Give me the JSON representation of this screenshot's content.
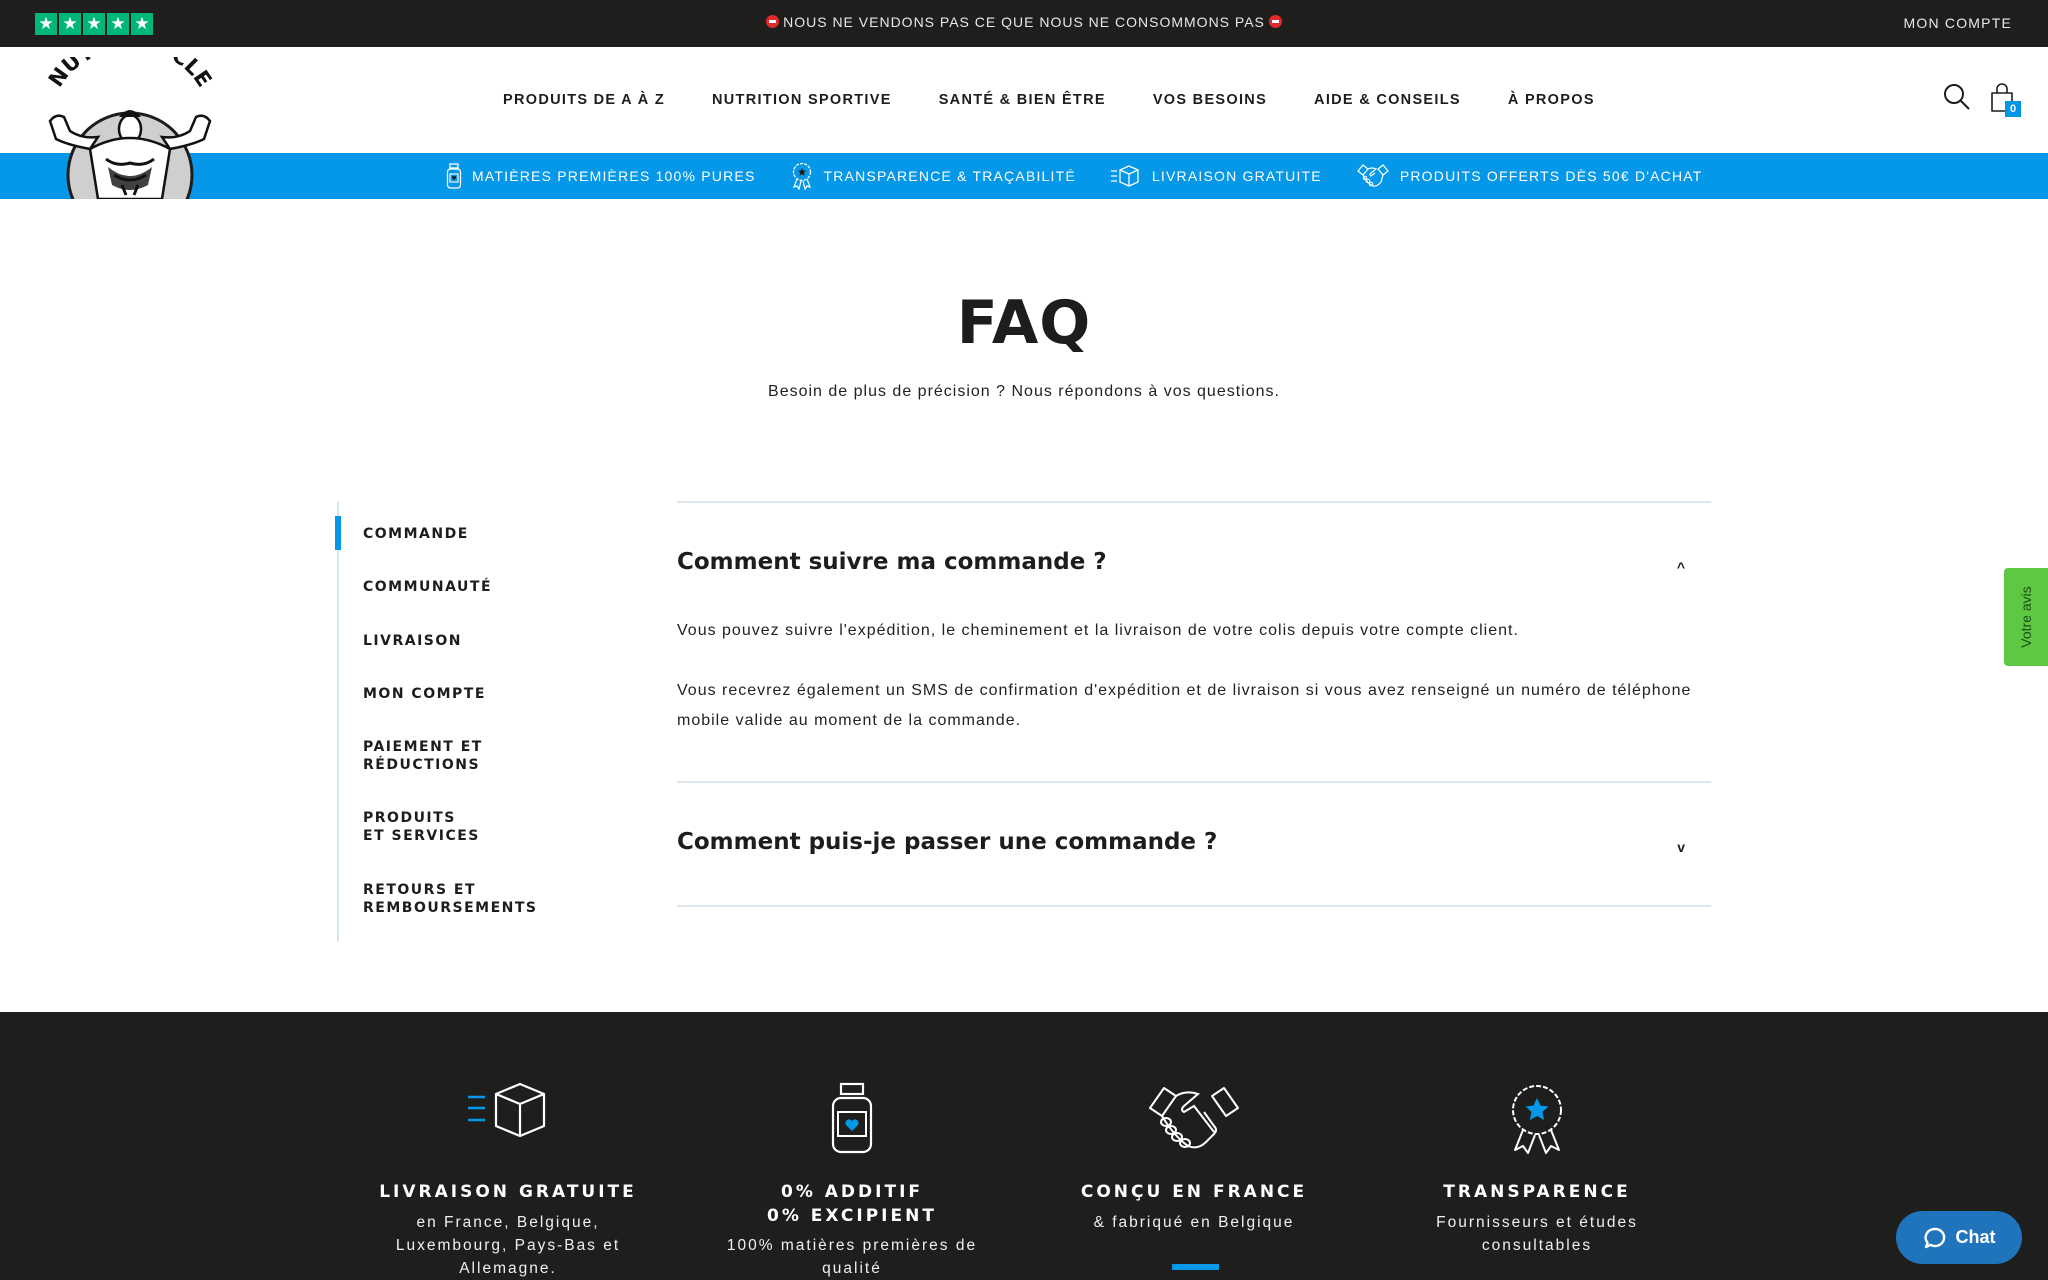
{
  "topbar": {
    "rating_stars": 5,
    "announcement": "NOUS NE VENDONS PAS CE QUE NOUS NE CONSOMMONS PAS",
    "account_link": "MON COMPTE"
  },
  "brand": {
    "name": "NUTRIMUSCLE"
  },
  "nav": {
    "items": [
      {
        "label": "PRODUITS DE A À Z"
      },
      {
        "label": "NUTRITION SPORTIVE"
      },
      {
        "label": "SANTÉ & BIEN ÊTRE"
      },
      {
        "label": "VOS BESOINS"
      },
      {
        "label": "AIDE & CONSEILS"
      },
      {
        "label": "À PROPOS"
      }
    ],
    "cart_count": "0"
  },
  "benefits": [
    {
      "icon": "jar-icon",
      "label": "MATIÈRES PREMIÈRES 100% PURES"
    },
    {
      "icon": "award-icon",
      "label": "TRANSPARENCE & TRAÇABILITÉ"
    },
    {
      "icon": "delivery-box-icon",
      "label": "LIVRAISON GRATUITE"
    },
    {
      "icon": "handshake-icon",
      "label": "PRODUITS OFFERTS DÈS 50€ D'ACHAT"
    }
  ],
  "hero": {
    "title": "FAQ",
    "subtitle": "Besoin de plus de précision ? Nous répondons à vos questions."
  },
  "sidebar": {
    "active": "COMMANDE",
    "items": [
      {
        "label": "COMMANDE"
      },
      {
        "label": "COMMUNAUTÉ"
      },
      {
        "label": "LIVRAISON"
      },
      {
        "label": "MON COMPTE"
      },
      {
        "label": "PAIEMENT ET RÉDUCTIONS"
      },
      {
        "label": "PRODUITS ET SERVICES"
      },
      {
        "label": "RETOURS ET REMBOURSEMENTS"
      }
    ]
  },
  "faq": [
    {
      "question": "Comment suivre ma commande ?",
      "expanded": true,
      "toggle": "^",
      "answer": [
        "Vous pouvez suivre l'expédition, le cheminement et la livraison de votre colis depuis votre compte client.",
        "Vous recevrez également un SMS de confirmation d'expédition et de livraison si vous avez renseigné un numéro de téléphone mobile valide au moment de la commande."
      ]
    },
    {
      "question": "Comment puis-je passer une commande ?",
      "expanded": false,
      "toggle": "v"
    }
  ],
  "footer_features": [
    {
      "icon": "delivery-box-icon",
      "title": "LIVRAISON GRATUITE",
      "text": "en France, Belgique, Luxembourg, Pays-Bas et Allemagne."
    },
    {
      "icon": "jar-heart-icon",
      "title": "0% ADDITIF\n0% EXCIPIENT",
      "title_lines": [
        "0% ADDITIF",
        "0% EXCIPIENT"
      ],
      "text": "100% matières premières de qualité"
    },
    {
      "icon": "handshake-icon",
      "title": "CONÇU EN FRANCE",
      "text": "& fabriqué en Belgique"
    },
    {
      "icon": "award-star-icon",
      "title": "TRANSPARENCE",
      "text": "Fournisseurs et études consultables"
    }
  ],
  "widgets": {
    "review_tab": "Votre avis",
    "chat": "Chat"
  },
  "colors": {
    "accent_blue": "#0597e8",
    "dark": "#1e1e1d",
    "trustpilot_green": "#00b67a",
    "review_green": "#5ec843",
    "chat_blue": "#1f74bc"
  }
}
